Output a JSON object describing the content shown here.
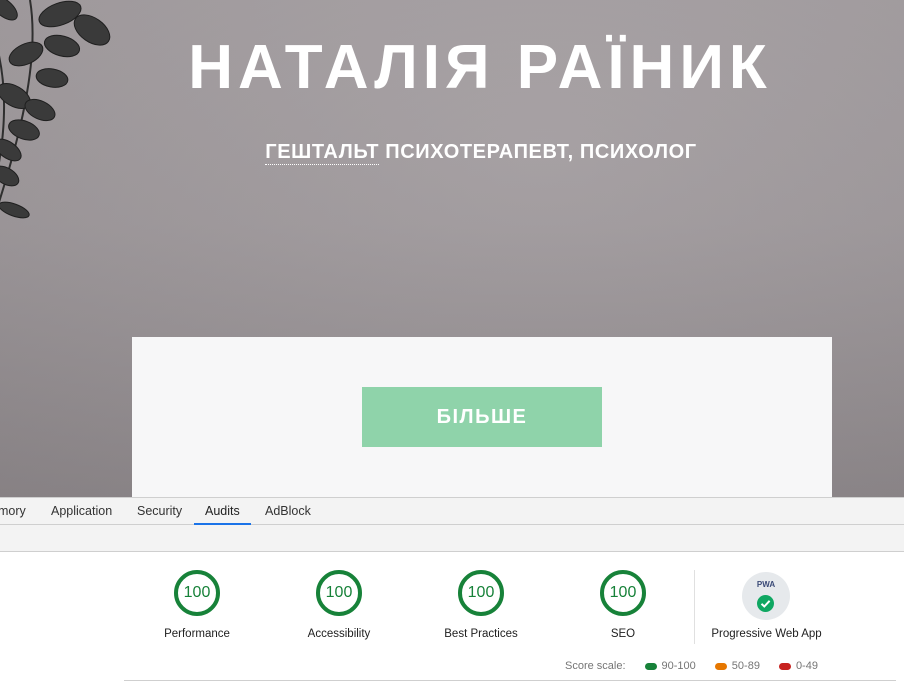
{
  "site": {
    "title": "НАТАЛІЯ РАЇНИК",
    "subtitle_term": "ГЕШТАЛЬТ",
    "subtitle_rest": " ПСИХОТЕРАПЕВТ, ПСИХОЛОГ",
    "more_button": "БІЛЬШЕ",
    "button_color": "#8fd3aa"
  },
  "devtools": {
    "tabs": [
      {
        "label": "mory"
      },
      {
        "label": "Application"
      },
      {
        "label": "Security"
      },
      {
        "label": "Audits",
        "active": true
      },
      {
        "label": "AdBlock"
      }
    ],
    "accent": "#1a73e8"
  },
  "audits": {
    "categories": [
      {
        "score": "100",
        "label": "Performance"
      },
      {
        "score": "100",
        "label": "Accessibility"
      },
      {
        "score": "100",
        "label": "Best Practices"
      },
      {
        "score": "100",
        "label": "SEO"
      }
    ],
    "pwa": {
      "badge_text": "PWA",
      "label": "Progressive Web App",
      "icon": "check-circle-icon"
    },
    "score_scale": {
      "label": "Score scale:",
      "ranges": [
        {
          "range": "90-100",
          "color": "#178239"
        },
        {
          "range": "50-89",
          "color": "#e67700"
        },
        {
          "range": "0-49",
          "color": "#c7221f"
        }
      ]
    },
    "pass_color": "#178239"
  }
}
